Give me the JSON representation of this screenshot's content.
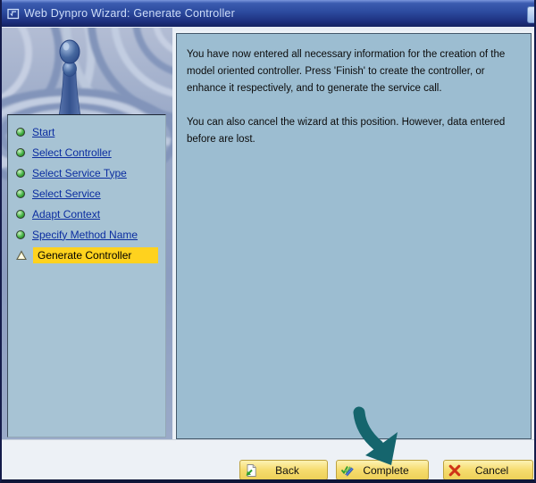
{
  "window": {
    "title": "Web Dynpro Wizard: Generate Controller"
  },
  "wizard_steps": {
    "items": [
      {
        "label": "Start",
        "state": "completed",
        "icon": "green-status-dot-icon"
      },
      {
        "label": "Select Controller",
        "state": "completed",
        "icon": "green-status-dot-icon"
      },
      {
        "label": "Select Service Type",
        "state": "completed",
        "icon": "green-status-dot-icon"
      },
      {
        "label": "Select Service",
        "state": "completed",
        "icon": "green-status-dot-icon"
      },
      {
        "label": "Adapt Context",
        "state": "completed",
        "icon": "green-status-dot-icon"
      },
      {
        "label": "Specify Method Name",
        "state": "completed",
        "icon": "green-status-dot-icon"
      },
      {
        "label": "Generate Controller",
        "state": "current",
        "icon": "current-step-triangle-icon"
      }
    ]
  },
  "content": {
    "paragraph1": "You have now entered all necessary information for the creation of the\nmodel oriented controller. Press 'Finish' to create the controller, or\nenhance it respectively, and to generate the service call.",
    "paragraph2": "You can also cancel the wizard at this position. However, data entered\nbefore are lost."
  },
  "footer": {
    "buttons": [
      {
        "label": "Back",
        "icon": "back-page-icon"
      },
      {
        "label": "Complete",
        "icon": "complete-check-pencil-icon"
      },
      {
        "label": "Cancel",
        "icon": "cancel-x-icon"
      }
    ]
  },
  "annotation": {
    "type": "arrow",
    "points_to": "Complete button",
    "color": "#15656D"
  },
  "colors": {
    "titlebar_blue": "#2C4A9E",
    "panel_blue": "#9CBDD1",
    "highlight_yellow": "#FFD21E",
    "button_yellow": "#F6DC6E",
    "link_blue": "#0B2DA0",
    "status_green": "#43B043",
    "cancel_red": "#CF3318",
    "arrow_teal": "#15656D"
  }
}
